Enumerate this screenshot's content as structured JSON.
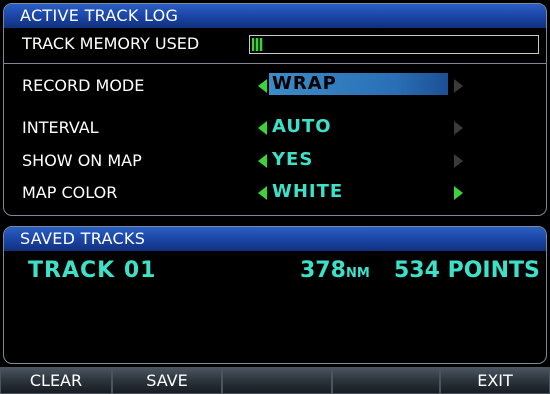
{
  "active_log": {
    "title": "ACTIVE TRACK LOG",
    "memory_label": "TRACK MEMORY USED",
    "memory_used_fraction": 0.04,
    "rows": [
      {
        "label": "RECORD MODE",
        "value": "WRAP",
        "selected": true,
        "right_arrow_active": false
      },
      {
        "label": "INTERVAL",
        "value": "AUTO",
        "selected": false,
        "right_arrow_active": false
      },
      {
        "label": "SHOW ON MAP",
        "value": "YES",
        "selected": false,
        "right_arrow_active": false
      },
      {
        "label": "MAP COLOR",
        "value": "WHITE",
        "selected": false,
        "right_arrow_active": true
      }
    ]
  },
  "saved_tracks": {
    "title": "SAVED TRACKS",
    "items": [
      {
        "name": "TRACK 01",
        "distance": "378",
        "distance_unit": "NM",
        "points": "534 POINTS"
      }
    ]
  },
  "softkeys": [
    "CLEAR",
    "SAVE",
    "",
    "",
    "EXIT"
  ],
  "colors": {
    "header_blue": "#1a43a3",
    "value_cyan": "#3de0c8",
    "arrow_green": "#3cd23c",
    "selection_blue": "#2a6fb5",
    "border_gray": "#7d8a96"
  }
}
